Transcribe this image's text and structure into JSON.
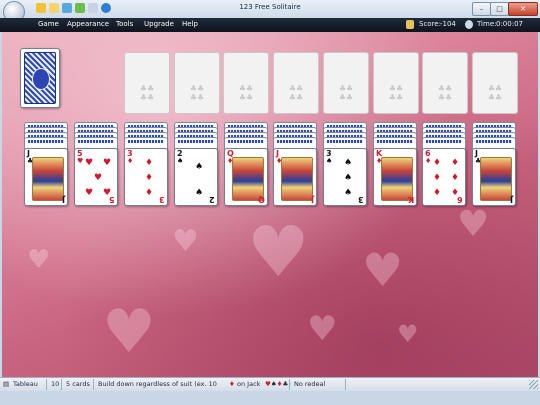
{
  "window": {
    "title": "123 Free Solitaire",
    "buttons": {
      "minimize": "–",
      "maximize": "□",
      "close": "✕"
    }
  },
  "menu": {
    "items": [
      "Game",
      "Appearance",
      "Tools",
      "Upgrade",
      "Help"
    ],
    "score_label": "Score:",
    "score_value": "-104",
    "time_label": "Time:",
    "time_value": "0:00:07"
  },
  "stock": {
    "icon": "card-back-icon"
  },
  "foundations": [
    {
      "pips": "♣♣\n♣♣"
    },
    {
      "pips": "♣♣\n♣♣"
    },
    {
      "pips": "♣♣\n♣♣"
    },
    {
      "pips": "♣♣\n♣♣"
    },
    {
      "pips": "♣♣\n♣♣"
    },
    {
      "pips": "♣♣\n♣♣"
    },
    {
      "pips": "♣♣\n♣♣"
    },
    {
      "pips": "♣♣\n♣♣"
    }
  ],
  "tableau": [
    {
      "rank": "J",
      "suit": "♣",
      "color": "blk"
    },
    {
      "rank": "5",
      "suit": "♥",
      "color": "red"
    },
    {
      "rank": "3",
      "suit": "♦",
      "color": "red"
    },
    {
      "rank": "2",
      "suit": "♠",
      "color": "blk"
    },
    {
      "rank": "Q",
      "suit": "♦",
      "color": "red"
    },
    {
      "rank": "J",
      "suit": "♦",
      "color": "red"
    },
    {
      "rank": "3",
      "suit": "♠",
      "color": "blk"
    },
    {
      "rank": "K",
      "suit": "♦",
      "color": "red"
    },
    {
      "rank": "6",
      "suit": "♦",
      "color": "red"
    },
    {
      "rank": "J",
      "suit": "♣",
      "color": "blk"
    }
  ],
  "status": {
    "game": "Tableau",
    "count": "10",
    "cards": "5 cards",
    "hint": "Build down regardless of suit (ex. 10",
    "hint_on": "on Jack",
    "redeal": "No redeal"
  },
  "colors": {
    "felt": "#d97f97",
    "menubar": "#141c28"
  }
}
